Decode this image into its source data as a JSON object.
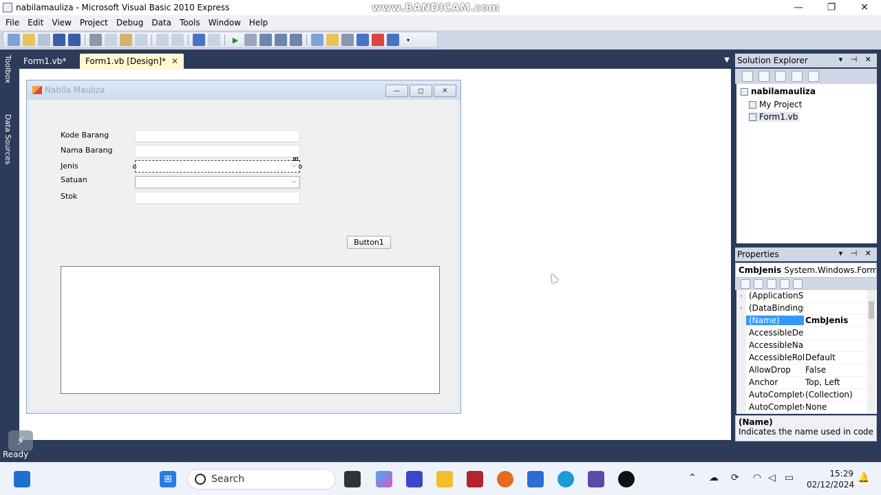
{
  "window": {
    "title": "nabilamauliza - Microsoft Visual Basic 2010 Express",
    "watermark": "www.BANDICAM.com",
    "minimize": "—",
    "maximize": "❐",
    "close": "✕"
  },
  "menu": [
    "File",
    "Edit",
    "View",
    "Project",
    "Debug",
    "Data",
    "Tools",
    "Window",
    "Help"
  ],
  "left_tabs": {
    "toolbox": "Toolbox",
    "data_sources": "Data Sources"
  },
  "doc_tabs": [
    {
      "label": "Form1.vb*"
    },
    {
      "label": "Form1.vb [Design]*",
      "close": "✕"
    }
  ],
  "form": {
    "title": "Nabila Mauliza",
    "min": "—",
    "max": "◻",
    "close": "✕",
    "labels": {
      "kode_barang": "Kode Barang",
      "nama_barang": "Nama Barang",
      "jenis": "Jenis",
      "satuan": "Satuan",
      "stok": "Stok"
    },
    "combo_arrow": "⌵",
    "button1": "Button1"
  },
  "solution_explorer": {
    "title": "Solution Explorer",
    "head_buttons": "▾ ⊣ ✕",
    "root": "nabilamauliza",
    "items": [
      "My Project",
      "Form1.vb"
    ]
  },
  "properties": {
    "title": "Properties",
    "head_buttons": "▾ ⊣ ✕",
    "object_name": "CmbJenis",
    "object_type": "System.Windows.Forms.ComboBox",
    "rows": [
      {
        "name": "(ApplicationSettings)",
        "value": "",
        "expander": "›"
      },
      {
        "name": "(DataBindings)",
        "value": "",
        "expander": "›"
      },
      {
        "name": "(Name)",
        "value": "CmbJenis",
        "expander": ""
      },
      {
        "name": "AccessibleDescription",
        "value": "",
        "expander": ""
      },
      {
        "name": "AccessibleName",
        "value": "",
        "expander": ""
      },
      {
        "name": "AccessibleRole",
        "value": "Default",
        "expander": ""
      },
      {
        "name": "AllowDrop",
        "value": "False",
        "expander": ""
      },
      {
        "name": "Anchor",
        "value": "Top, Left",
        "expander": ""
      },
      {
        "name": "AutoCompleteCustomSource",
        "value": "(Collection)",
        "expander": ""
      },
      {
        "name": "AutoCompleteMode",
        "value": "None",
        "expander": ""
      }
    ],
    "desc_name": "(Name)",
    "desc_text": "Indicates the name used in code to identify the object."
  },
  "status": {
    "text": "Ready"
  },
  "taskbar": {
    "search_placeholder": "Search",
    "time": "15:29",
    "date": "02/12/2024"
  }
}
